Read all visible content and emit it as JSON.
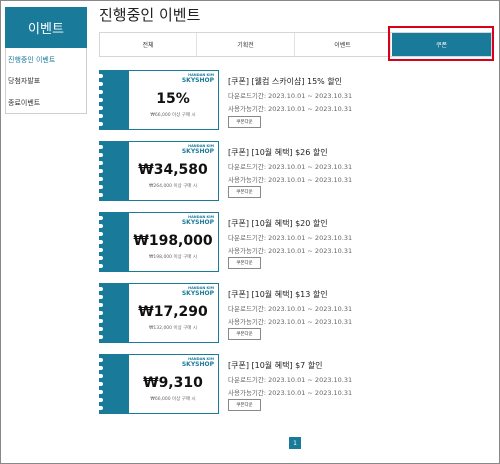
{
  "sidebar": {
    "header": "이벤트",
    "items": [
      {
        "label": "진행중인 이벤트",
        "active": true
      },
      {
        "label": "당첨자발표",
        "active": false
      },
      {
        "label": "종료이벤트",
        "active": false
      }
    ]
  },
  "page": {
    "title": "진행중인 이벤트"
  },
  "tabs": [
    {
      "label": "전체",
      "active": false
    },
    {
      "label": "기획전",
      "active": false
    },
    {
      "label": "이벤트",
      "active": false
    },
    {
      "label": "쿠폰",
      "active": true
    }
  ],
  "brand": {
    "small": "HANDAN KIM",
    "main": "SKYSHOP"
  },
  "coupons": [
    {
      "amount": "15%",
      "condition": "₩66,000 이상 구매 시",
      "title": "[쿠폰] [웰컴 스카이샵] 15% 할인",
      "download_period": "다운로드기간: 2023.10.01 ~ 2023.10.31",
      "use_period": "사용가능기간: 2023.10.01 ~ 2023.10.31",
      "button": "쿠폰다운"
    },
    {
      "amount": "₩34,580",
      "condition": "₩264,000 이상 구매 시",
      "title": "[쿠폰] [10월 혜택] $26 할인",
      "download_period": "다운로드기간: 2023.10.01 ~ 2023.10.31",
      "use_period": "사용가능기간: 2023.10.01 ~ 2023.10.31",
      "button": "쿠폰다운"
    },
    {
      "amount": "₩198,000",
      "condition": "₩198,000 이상 구매 시",
      "title": "[쿠폰] [10월 혜택] $20 할인",
      "download_period": "다운로드기간: 2023.10.01 ~ 2023.10.31",
      "use_period": "사용가능기간: 2023.10.01 ~ 2023.10.31",
      "button": "쿠폰다운"
    },
    {
      "amount": "₩17,290",
      "condition": "₩132,000 이상 구매 시",
      "title": "[쿠폰] [10월 혜택] $13 할인",
      "download_period": "다운로드기간: 2023.10.01 ~ 2023.10.31",
      "use_period": "사용가능기간: 2023.10.01 ~ 2023.10.31",
      "button": "쿠폰다운"
    },
    {
      "amount": "₩9,310",
      "condition": "₩66,000 이상 구매 시",
      "title": "[쿠폰] [10월 혜택] $7 할인",
      "download_period": "다운로드기간: 2023.10.01 ~ 2023.10.31",
      "use_period": "사용가능기간: 2023.10.01 ~ 2023.10.31",
      "button": "쿠폰다운"
    }
  ],
  "pagination": {
    "current": "1"
  },
  "colors": {
    "accent": "#1a7a9a",
    "highlight": "#d9001b"
  }
}
